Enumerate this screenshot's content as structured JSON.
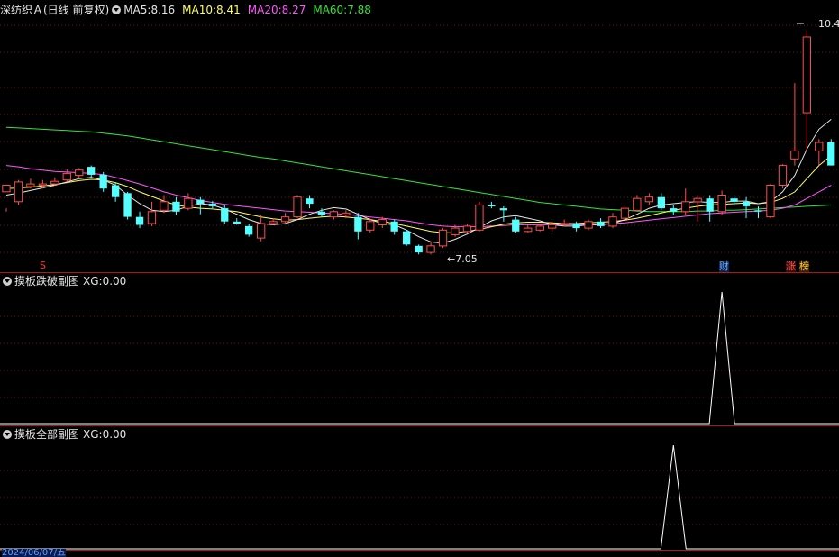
{
  "main": {
    "title": "深纺织Ａ(日线 前复权)",
    "ma": [
      {
        "label": "MA5: ",
        "value": "8.16",
        "color": "#e6e6e6"
      },
      {
        "label": "MA10: ",
        "value": "8.41",
        "color": "#ffff55"
      },
      {
        "label": "MA20: ",
        "value": "8.27",
        "color": "#ff55ff"
      },
      {
        "label": "MA60: ",
        "value": "7.88",
        "color": "#33e533"
      }
    ],
    "high_label": "10.4",
    "low_label": "7.05",
    "markers": {
      "s": "S",
      "cai": "财",
      "zhang": "涨",
      "bang": "榜"
    }
  },
  "sub1": {
    "title": "摸板跌破副图",
    "xg_label": "XG: ",
    "xg_value": "0.00"
  },
  "sub2": {
    "title": "摸板全部副图",
    "xg_label": "XG: ",
    "xg_value": "0.00"
  },
  "date_label": "2024/06/07/五",
  "colors": {
    "up": "#ff4d4d",
    "down": "#55ffff",
    "ma5": "#e6e6e6",
    "ma10": "#ffff55",
    "ma20": "#ff55ff",
    "ma60": "#33e533",
    "grid": "#7a1010",
    "border": "#b01818"
  },
  "chart_data": [
    {
      "type": "candlestick",
      "y_range": [
        7.0,
        10.5
      ],
      "candles": [
        [
          8.0,
          8.1,
          7.75,
          7.7
        ],
        [
          7.85,
          8.15,
          8.18,
          7.8
        ],
        [
          8.08,
          8.12,
          8.2,
          8.05
        ],
        [
          8.1,
          8.12,
          8.18,
          8.05
        ],
        [
          8.12,
          8.16,
          8.22,
          8.1
        ],
        [
          8.18,
          8.28,
          8.34,
          8.15
        ],
        [
          8.25,
          8.33,
          8.36,
          8.2
        ],
        [
          8.38,
          8.26,
          8.4,
          8.22
        ],
        [
          8.26,
          8.05,
          8.3,
          8.0
        ],
        [
          8.1,
          7.92,
          8.14,
          7.85
        ],
        [
          7.98,
          7.62,
          8.0,
          7.58
        ],
        [
          7.62,
          7.5,
          7.7,
          7.45
        ],
        [
          7.52,
          7.7,
          7.85,
          7.48
        ],
        [
          7.72,
          7.85,
          7.95,
          7.68
        ],
        [
          7.85,
          7.7,
          7.92,
          7.65
        ],
        [
          7.75,
          7.9,
          7.98,
          7.72
        ],
        [
          7.88,
          7.82,
          7.92,
          7.66
        ],
        [
          7.82,
          7.78,
          7.86,
          7.75
        ],
        [
          7.75,
          7.55,
          7.8,
          7.52
        ],
        [
          7.55,
          7.52,
          7.6,
          7.5
        ],
        [
          7.48,
          7.35,
          7.52,
          7.32
        ],
        [
          7.3,
          7.52,
          7.65,
          7.25
        ],
        [
          7.52,
          7.55,
          7.6,
          7.5
        ],
        [
          7.55,
          7.62,
          7.68,
          7.52
        ],
        [
          7.62,
          7.92,
          7.95,
          7.6
        ],
        [
          7.9,
          7.82,
          7.95,
          7.75
        ],
        [
          7.7,
          7.65,
          7.75,
          7.62
        ],
        [
          7.62,
          7.7,
          7.72,
          7.58
        ],
        [
          7.65,
          7.68,
          7.72,
          7.6
        ],
        [
          7.62,
          7.4,
          7.68,
          7.28
        ],
        [
          7.42,
          7.55,
          7.6,
          7.38
        ],
        [
          7.5,
          7.58,
          7.62,
          7.45
        ],
        [
          7.55,
          7.4,
          7.58,
          7.35
        ],
        [
          7.4,
          7.2,
          7.42,
          7.18
        ],
        [
          7.18,
          7.08,
          7.2,
          7.05
        ],
        [
          7.08,
          7.18,
          7.25,
          7.05
        ],
        [
          7.18,
          7.42,
          7.45,
          7.15
        ],
        [
          7.35,
          7.45,
          7.5,
          7.32
        ],
        [
          7.4,
          7.48,
          7.52,
          7.38
        ],
        [
          7.42,
          7.8,
          7.85,
          7.4
        ],
        [
          7.8,
          7.78,
          7.85,
          7.75
        ],
        [
          7.75,
          7.72,
          7.78,
          7.55
        ],
        [
          7.58,
          7.4,
          7.62,
          7.38
        ],
        [
          7.4,
          7.45,
          7.5,
          7.38
        ],
        [
          7.42,
          7.48,
          7.52,
          7.4
        ],
        [
          7.45,
          7.5,
          7.55,
          7.4
        ],
        [
          7.5,
          7.52,
          7.58,
          7.48
        ],
        [
          7.52,
          7.45,
          7.55,
          7.4
        ],
        [
          7.45,
          7.55,
          7.58,
          7.42
        ],
        [
          7.55,
          7.48,
          7.6,
          7.45
        ],
        [
          7.48,
          7.62,
          7.68,
          7.45
        ],
        [
          7.6,
          7.75,
          7.8,
          7.58
        ],
        [
          7.72,
          7.9,
          7.95,
          7.7
        ],
        [
          7.85,
          7.92,
          7.98,
          7.8
        ],
        [
          7.92,
          7.75,
          7.98,
          7.72
        ],
        [
          7.75,
          7.7,
          7.8,
          7.65
        ],
        [
          7.7,
          7.85,
          8.05,
          7.65
        ],
        [
          7.85,
          7.9,
          7.95,
          7.55
        ],
        [
          7.9,
          7.7,
          7.95,
          7.55
        ],
        [
          7.7,
          7.95,
          8.02,
          7.65
        ],
        [
          7.9,
          7.85,
          7.95,
          7.8
        ],
        [
          7.85,
          7.78,
          7.92,
          7.6
        ],
        [
          7.72,
          7.7,
          7.78,
          7.6
        ],
        [
          7.62,
          8.1,
          8.12,
          7.6
        ],
        [
          8.1,
          8.4,
          8.42,
          8.05
        ],
        [
          8.5,
          8.62,
          9.65,
          8.4
        ],
        [
          9.2,
          10.35,
          10.45,
          8.62
        ],
        [
          8.62,
          8.75,
          8.8,
          8.4
        ],
        [
          8.75,
          8.4,
          8.8,
          8.4
        ]
      ],
      "ma_lines": {
        "ma5": [
          7.95,
          7.98,
          8.02,
          8.06,
          8.1,
          8.15,
          8.2,
          8.22,
          8.18,
          8.1,
          7.95,
          7.82,
          7.72,
          7.7,
          7.72,
          7.78,
          7.82,
          7.8,
          7.74,
          7.66,
          7.58,
          7.52,
          7.5,
          7.52,
          7.58,
          7.66,
          7.72,
          7.76,
          7.74,
          7.66,
          7.58,
          7.52,
          7.5,
          7.42,
          7.32,
          7.24,
          7.22,
          7.28,
          7.36,
          7.46,
          7.56,
          7.62,
          7.64,
          7.6,
          7.56,
          7.5,
          7.48,
          7.48,
          7.5,
          7.5,
          7.52,
          7.58,
          7.66,
          7.75,
          7.8,
          7.82,
          7.84,
          7.85,
          7.84,
          7.84,
          7.86,
          7.86,
          7.82,
          7.85,
          8.0,
          8.25,
          8.65,
          8.95,
          9.1
        ],
        "ma10": [
          8.05,
          8.06,
          8.07,
          8.09,
          8.11,
          8.14,
          8.17,
          8.19,
          8.18,
          8.14,
          8.08,
          8.0,
          7.93,
          7.86,
          7.8,
          7.77,
          7.75,
          7.74,
          7.72,
          7.7,
          7.66,
          7.62,
          7.59,
          7.57,
          7.58,
          7.6,
          7.62,
          7.63,
          7.62,
          7.6,
          7.58,
          7.55,
          7.52,
          7.48,
          7.44,
          7.4,
          7.38,
          7.38,
          7.4,
          7.43,
          7.47,
          7.51,
          7.53,
          7.54,
          7.54,
          7.53,
          7.52,
          7.52,
          7.53,
          7.54,
          7.55,
          7.57,
          7.6,
          7.64,
          7.68,
          7.72,
          7.75,
          7.78,
          7.8,
          7.81,
          7.82,
          7.83,
          7.82,
          7.84,
          7.9,
          8.0,
          8.2,
          8.4,
          8.55
        ],
        "ma20": [
          8.4,
          8.38,
          8.35,
          8.33,
          8.31,
          8.3,
          8.29,
          8.28,
          8.26,
          8.22,
          8.17,
          8.12,
          8.06,
          8.0,
          7.95,
          7.91,
          7.87,
          7.84,
          7.81,
          7.79,
          7.77,
          7.75,
          7.73,
          7.71,
          7.7,
          7.69,
          7.68,
          7.67,
          7.66,
          7.64,
          7.62,
          7.6,
          7.58,
          7.56,
          7.53,
          7.5,
          7.48,
          7.47,
          7.47,
          7.47,
          7.48,
          7.49,
          7.5,
          7.5,
          7.5,
          7.5,
          7.5,
          7.5,
          7.5,
          7.51,
          7.52,
          7.53,
          7.55,
          7.57,
          7.59,
          7.61,
          7.63,
          7.65,
          7.67,
          7.68,
          7.69,
          7.7,
          7.71,
          7.72,
          7.75,
          7.8,
          7.9,
          8.0,
          8.1
        ],
        "ma60": [
          8.98,
          8.97,
          8.96,
          8.95,
          8.94,
          8.93,
          8.92,
          8.91,
          8.89,
          8.87,
          8.85,
          8.82,
          8.79,
          8.76,
          8.73,
          8.7,
          8.67,
          8.64,
          8.61,
          8.58,
          8.55,
          8.52,
          8.5,
          8.47,
          8.44,
          8.41,
          8.38,
          8.35,
          8.32,
          8.29,
          8.26,
          8.23,
          8.2,
          8.17,
          8.14,
          8.11,
          8.08,
          8.05,
          8.02,
          7.99,
          7.96,
          7.93,
          7.9,
          7.87,
          7.84,
          7.82,
          7.8,
          7.78,
          7.76,
          7.74,
          7.73,
          7.72,
          7.71,
          7.7,
          7.7,
          7.7,
          7.7,
          7.71,
          7.71,
          7.72,
          7.72,
          7.73,
          7.74,
          7.75,
          7.76,
          7.77,
          7.78,
          7.79,
          7.8
        ]
      }
    },
    {
      "type": "line",
      "name": "XG",
      "x": [
        0,
        1
      ],
      "y": [
        0,
        0
      ],
      "peak_at_candle": 59,
      "ylim": [
        0,
        1
      ]
    },
    {
      "type": "line",
      "name": "XG",
      "x": [
        0,
        1
      ],
      "y": [
        0,
        0
      ],
      "peak_at_candle": 55,
      "ylim": [
        0,
        1
      ]
    }
  ]
}
